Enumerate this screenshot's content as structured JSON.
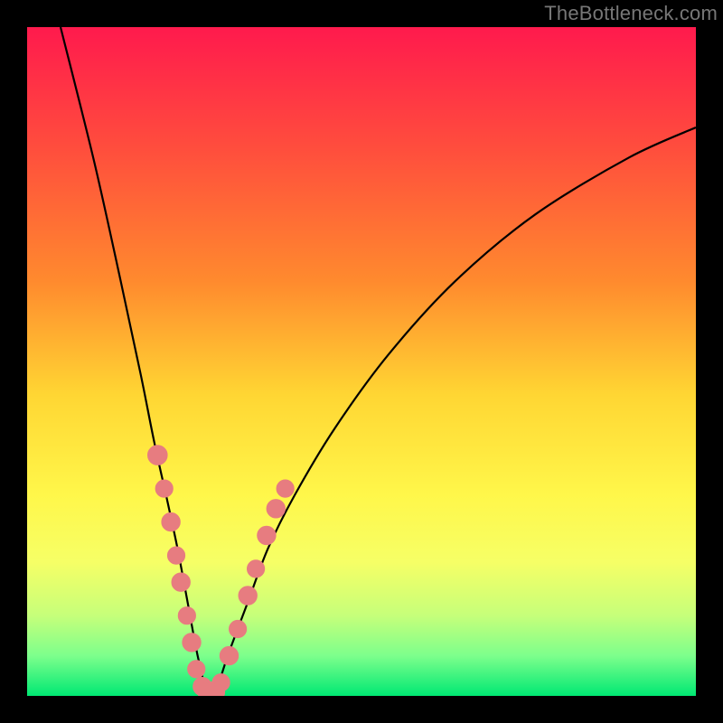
{
  "watermark": "TheBottleneck.com",
  "chart_data": {
    "type": "line",
    "title": "",
    "xlabel": "",
    "ylabel": "",
    "xlim": [
      0,
      100
    ],
    "ylim": [
      0,
      100
    ],
    "series": [
      {
        "name": "bottleneck-curve",
        "x": [
          5,
          10,
          14,
          17,
          19,
          21,
          22.5,
          24,
          25.5,
          27,
          28,
          30,
          33,
          36,
          40,
          46,
          54,
          64,
          76,
          90,
          100
        ],
        "y": [
          100,
          80,
          62,
          48,
          38,
          29,
          22,
          14,
          6,
          0,
          0,
          6,
          14,
          22,
          30,
          40,
          51,
          62,
          72,
          80.5,
          85
        ]
      }
    ],
    "markers": {
      "name": "highlight-points",
      "color": "#e77c80",
      "points": [
        {
          "x": 19.5,
          "y": 36,
          "r": 1.8
        },
        {
          "x": 20.5,
          "y": 31,
          "r": 1.6
        },
        {
          "x": 21.5,
          "y": 26,
          "r": 1.7
        },
        {
          "x": 22.3,
          "y": 21,
          "r": 1.6
        },
        {
          "x": 23.0,
          "y": 17,
          "r": 1.7
        },
        {
          "x": 23.9,
          "y": 12,
          "r": 1.6
        },
        {
          "x": 24.6,
          "y": 8,
          "r": 1.7
        },
        {
          "x": 25.3,
          "y": 4,
          "r": 1.6
        },
        {
          "x": 26.2,
          "y": 1.4,
          "r": 1.7
        },
        {
          "x": 27.0,
          "y": 0.6,
          "r": 1.8
        },
        {
          "x": 28.0,
          "y": 0.6,
          "r": 1.9
        },
        {
          "x": 29.0,
          "y": 2,
          "r": 1.6
        },
        {
          "x": 30.2,
          "y": 6,
          "r": 1.7
        },
        {
          "x": 31.5,
          "y": 10,
          "r": 1.6
        },
        {
          "x": 33.0,
          "y": 15,
          "r": 1.7
        },
        {
          "x": 34.2,
          "y": 19,
          "r": 1.6
        },
        {
          "x": 35.8,
          "y": 24,
          "r": 1.7
        },
        {
          "x": 37.2,
          "y": 28,
          "r": 1.7
        },
        {
          "x": 38.6,
          "y": 31,
          "r": 1.6
        }
      ]
    },
    "background_gradient": {
      "top": "#ff1a4d",
      "middle": "#ffd633",
      "bottom": "#00e873"
    }
  }
}
